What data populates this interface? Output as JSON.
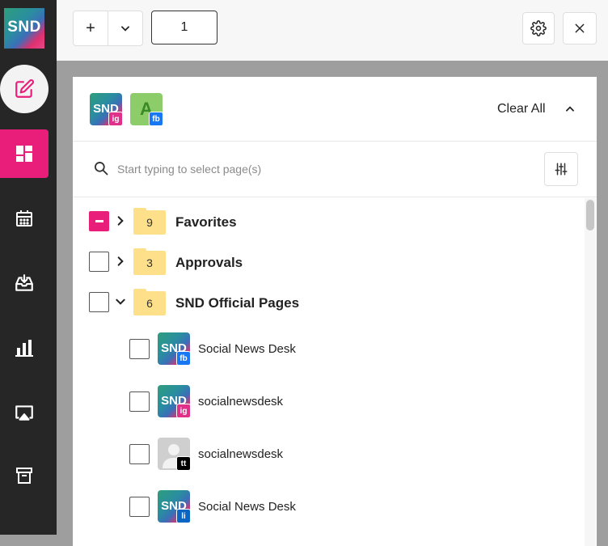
{
  "logo": {
    "text": "SND"
  },
  "sidebar": {
    "items": [
      {
        "name": "compose",
        "icon": "edit-icon"
      },
      {
        "name": "dashboard",
        "icon": "dashboard-icon",
        "active": true
      },
      {
        "name": "calendar",
        "icon": "calendar-icon"
      },
      {
        "name": "inbox",
        "icon": "inbox-icon"
      },
      {
        "name": "analytics",
        "icon": "bar-chart-icon"
      },
      {
        "name": "broadcast",
        "icon": "airplay-icon"
      },
      {
        "name": "archive",
        "icon": "archive-icon"
      }
    ],
    "active_color": "#e91e7a"
  },
  "toolbar": {
    "add_label": "+",
    "count_value": "1"
  },
  "selected_header": {
    "avatars": [
      {
        "text": "SND",
        "network": "ig"
      },
      {
        "text": "A",
        "network": "fb"
      }
    ],
    "clear_all_label": "Clear All"
  },
  "search": {
    "placeholder": "Start typing to select page(s)"
  },
  "groups": [
    {
      "label": "Favorites",
      "count": "9",
      "checkbox": "partial",
      "expanded": false
    },
    {
      "label": "Approvals",
      "count": "3",
      "checkbox": "unchecked",
      "expanded": false
    },
    {
      "label": "SND Official Pages",
      "count": "6",
      "checkbox": "unchecked",
      "expanded": true
    }
  ],
  "pages": [
    {
      "label": "Social News Desk",
      "avatar_text": "SND",
      "network": "fb"
    },
    {
      "label": "socialnewsdesk",
      "avatar_text": "SND",
      "network": "ig"
    },
    {
      "label": "socialnewsdesk",
      "avatar_text": "",
      "network": "tt"
    },
    {
      "label": "Social News Desk",
      "avatar_text": "SND",
      "network": "li"
    }
  ]
}
